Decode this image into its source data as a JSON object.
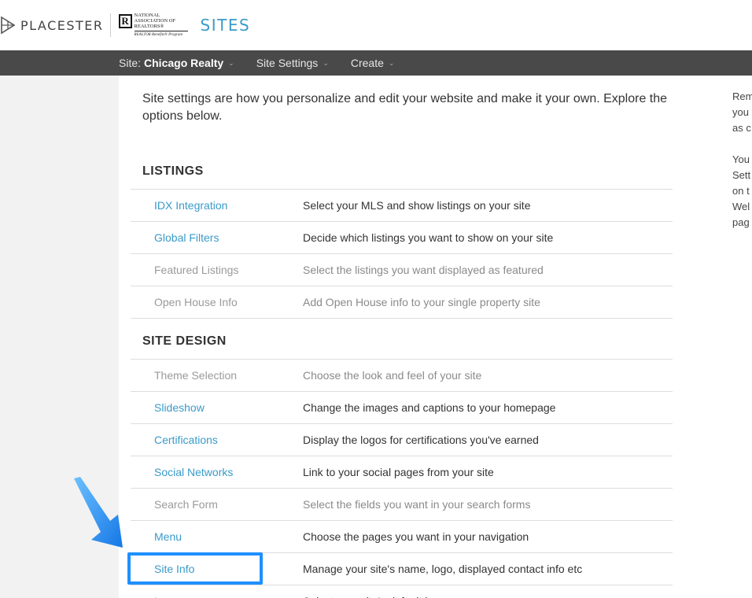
{
  "header": {
    "brand": "PLACESTER",
    "nar_logo": {
      "letter": "R",
      "lines": [
        "National",
        "Association of",
        "Realtors®"
      ],
      "program": "REALTOR Benefits® Program"
    },
    "app_title": "SITES"
  },
  "nav": {
    "site_label": "Site:",
    "site_name": "Chicago Realty",
    "settings": "Site Settings",
    "create": "Create"
  },
  "intro": "Site settings are how you personalize and edit your website and make it your own. Explore the options below.",
  "sections": [
    {
      "title": "LISTINGS",
      "rows": [
        {
          "label": "IDX Integration",
          "desc": "Select your MLS and show listings on your site",
          "enabled": true
        },
        {
          "label": "Global Filters",
          "desc": "Decide which listings you want to show on your site",
          "enabled": true
        },
        {
          "label": "Featured Listings",
          "desc": "Select the listings you want displayed as featured",
          "enabled": false
        },
        {
          "label": "Open House Info",
          "desc": "Add Open House info to your single property site",
          "enabled": false
        }
      ]
    },
    {
      "title": "SITE DESIGN",
      "rows": [
        {
          "label": "Theme Selection",
          "desc": "Choose the look and feel of your site",
          "enabled": false
        },
        {
          "label": "Slideshow",
          "desc": "Change the images and captions to your homepage",
          "enabled": true
        },
        {
          "label": "Certifications",
          "desc": "Display the logos for certifications you've earned",
          "enabled": true
        },
        {
          "label": "Social Networks",
          "desc": "Link to your social pages from your site",
          "enabled": true
        },
        {
          "label": "Search Form",
          "desc": "Select the fields you want in your search forms",
          "enabled": false
        },
        {
          "label": "Menu",
          "desc": "Choose the pages you want in your navigation",
          "enabled": true
        },
        {
          "label": "Site Info",
          "desc": "Manage your site's name, logo, displayed contact info etc",
          "enabled": true
        },
        {
          "label": "L",
          "desc": "Select your site's default la",
          "enabled": true
        }
      ]
    }
  ],
  "right_panel": {
    "para1": [
      "Rem",
      "you",
      "as c"
    ],
    "para2": [
      "You",
      "Sett",
      "on t",
      "Wel",
      "pag"
    ]
  },
  "colors": {
    "accent": "#3a9ac9",
    "navbar": "#494949",
    "highlight": "#1e90ff"
  }
}
